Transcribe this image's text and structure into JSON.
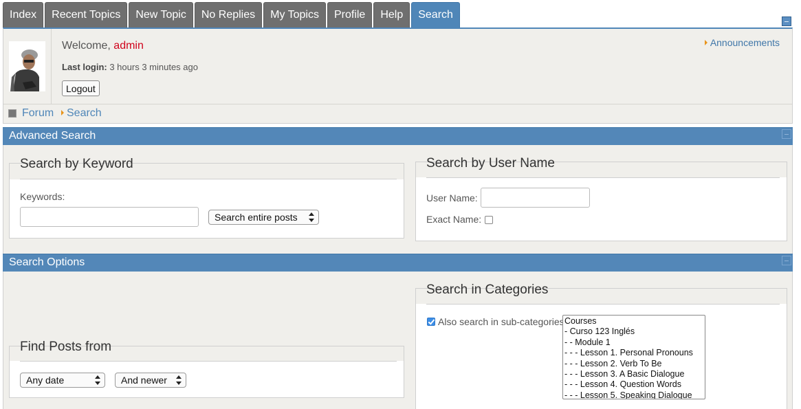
{
  "tabs": [
    {
      "label": "Index",
      "active": false
    },
    {
      "label": "Recent Topics",
      "active": false
    },
    {
      "label": "New Topic",
      "active": false
    },
    {
      "label": "No Replies",
      "active": false
    },
    {
      "label": "My Topics",
      "active": false
    },
    {
      "label": "Profile",
      "active": false
    },
    {
      "label": "Help",
      "active": false
    },
    {
      "label": "Search",
      "active": true
    }
  ],
  "user": {
    "welcome_prefix": "Welcome,",
    "name": "admin",
    "last_login_label": "Last login:",
    "last_login_value": "3 hours 3 minutes ago",
    "logout_label": "Logout"
  },
  "announcements_label": "Announcements",
  "breadcrumb": {
    "forum": "Forum",
    "search": "Search"
  },
  "advanced_search": {
    "title": "Advanced Search",
    "keyword": {
      "legend": "Search by Keyword",
      "keywords_label": "Keywords:",
      "keywords_value": "",
      "scope_selected": "Search entire posts"
    },
    "username": {
      "legend": "Search by User Name",
      "username_label": "User Name:",
      "username_value": "",
      "exact_label": "Exact Name:",
      "exact_checked": false
    }
  },
  "search_options": {
    "title": "Search Options",
    "find_posts": {
      "legend": "Find Posts from",
      "date_selected": "Any date",
      "direction_selected": "And newer"
    },
    "categories": {
      "legend": "Search in Categories",
      "subcat_label": "Also search in sub-categories",
      "subcat_checked": true,
      "options": [
        "Courses",
        "- Curso 123 Inglés",
        "- - Module 1",
        "- - - Lesson 1. Personal Pronouns",
        "- - - Lesson 2. Verb To Be",
        "- - - Lesson 3. A Basic Dialogue",
        "- - - Lesson 4. Question Words",
        "- - - Lesson 5. Speaking Dialogue"
      ]
    }
  },
  "colors": {
    "accent": "#4f86b8",
    "tab_gray": "#6f6f6f",
    "username_red": "#d0021b",
    "panel_bg": "#f0efeb"
  },
  "icons": {
    "toggle": "collapse-square-icon",
    "breadcrumb_home": "square-icon",
    "bullet": "orange-triangle-icon"
  }
}
